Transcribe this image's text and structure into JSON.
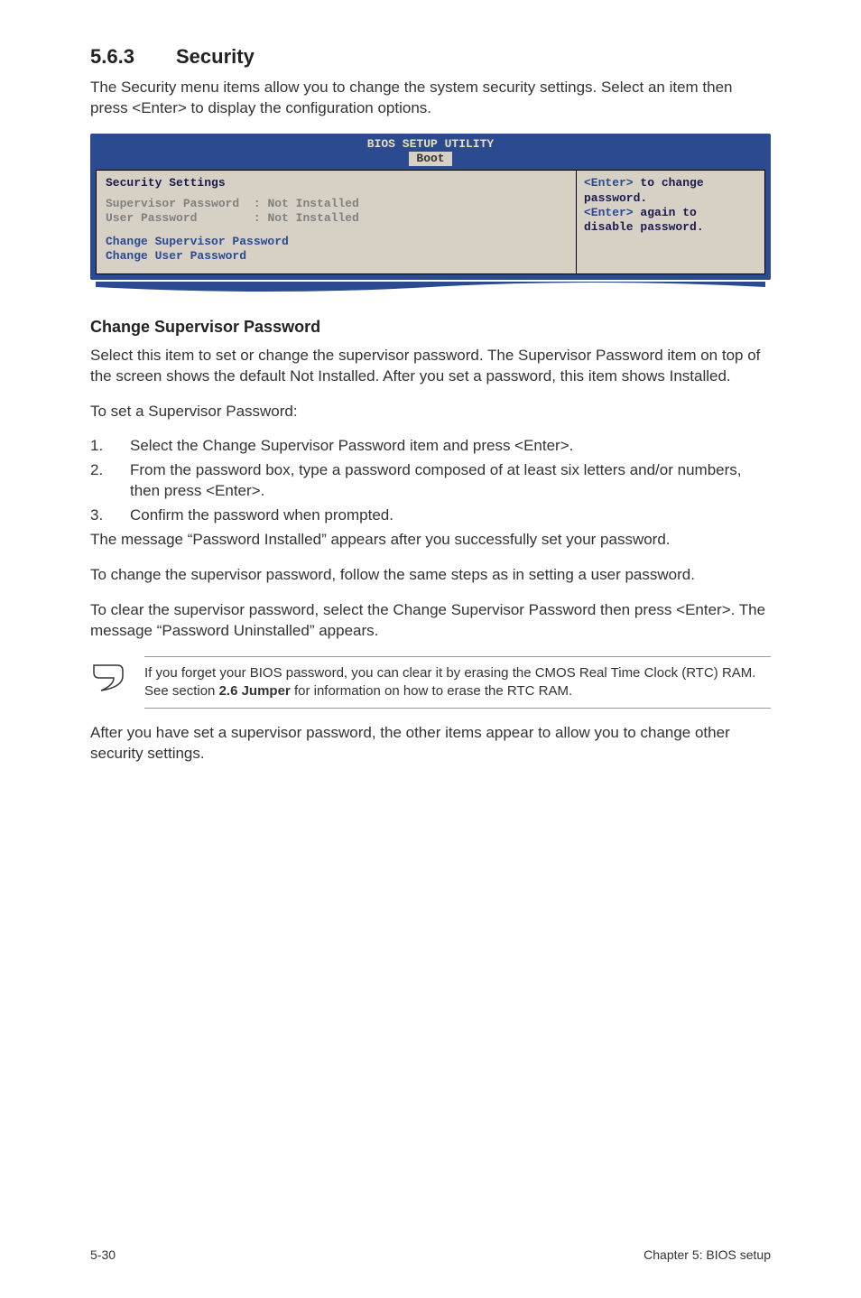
{
  "heading": {
    "number": "5.6.3",
    "title": "Security"
  },
  "intro": "The Security menu items allow you to change the system security settings. Select an item then press <Enter> to display the configuration options.",
  "bios": {
    "title": "BIOS SETUP UTILITY",
    "active_tab": "Boot",
    "section_title": "Security Settings",
    "items": [
      {
        "label": "Supervisor Password",
        "value": ": Not Installed"
      },
      {
        "label": "User Password",
        "value": ": Not Installed"
      }
    ],
    "actions": [
      "Change Supervisor Password",
      "Change User Password"
    ],
    "help": {
      "line1_key": "<Enter>",
      "line1_rest": " to change",
      "line2": "password.",
      "line3_key": "<Enter>",
      "line3_rest": " again to",
      "line4": "disable password."
    }
  },
  "subheading": "Change Supervisor Password",
  "para1": "Select this item to set or change the supervisor password. The Supervisor Password item on top of the screen shows the default Not Installed. After you set a password, this item shows Installed.",
  "para2": "To set a Supervisor Password:",
  "steps": [
    "Select the Change Supervisor Password item and press <Enter>.",
    "From the password box, type a password composed of at least six letters and/or numbers, then press <Enter>.",
    "Confirm the password when prompted."
  ],
  "after_steps": "The message “Password Installed” appears after you successfully set your password.",
  "para3": "To change the supervisor password, follow the same steps as in setting a user password.",
  "para4": "To clear the supervisor password, select the Change Supervisor Password then press <Enter>. The message “Password Uninstalled” appears.",
  "note": {
    "pre": "If you forget your BIOS password, you can clear it by erasing the CMOS Real Time Clock (RTC) RAM. See section ",
    "bold": "2.6 Jumper",
    "post": " for information on how to erase the RTC RAM."
  },
  "para5": "After you have set a supervisor password, the other items appear to allow you to change other security settings.",
  "footer": {
    "left": "5-30",
    "right": "Chapter 5: BIOS setup"
  }
}
